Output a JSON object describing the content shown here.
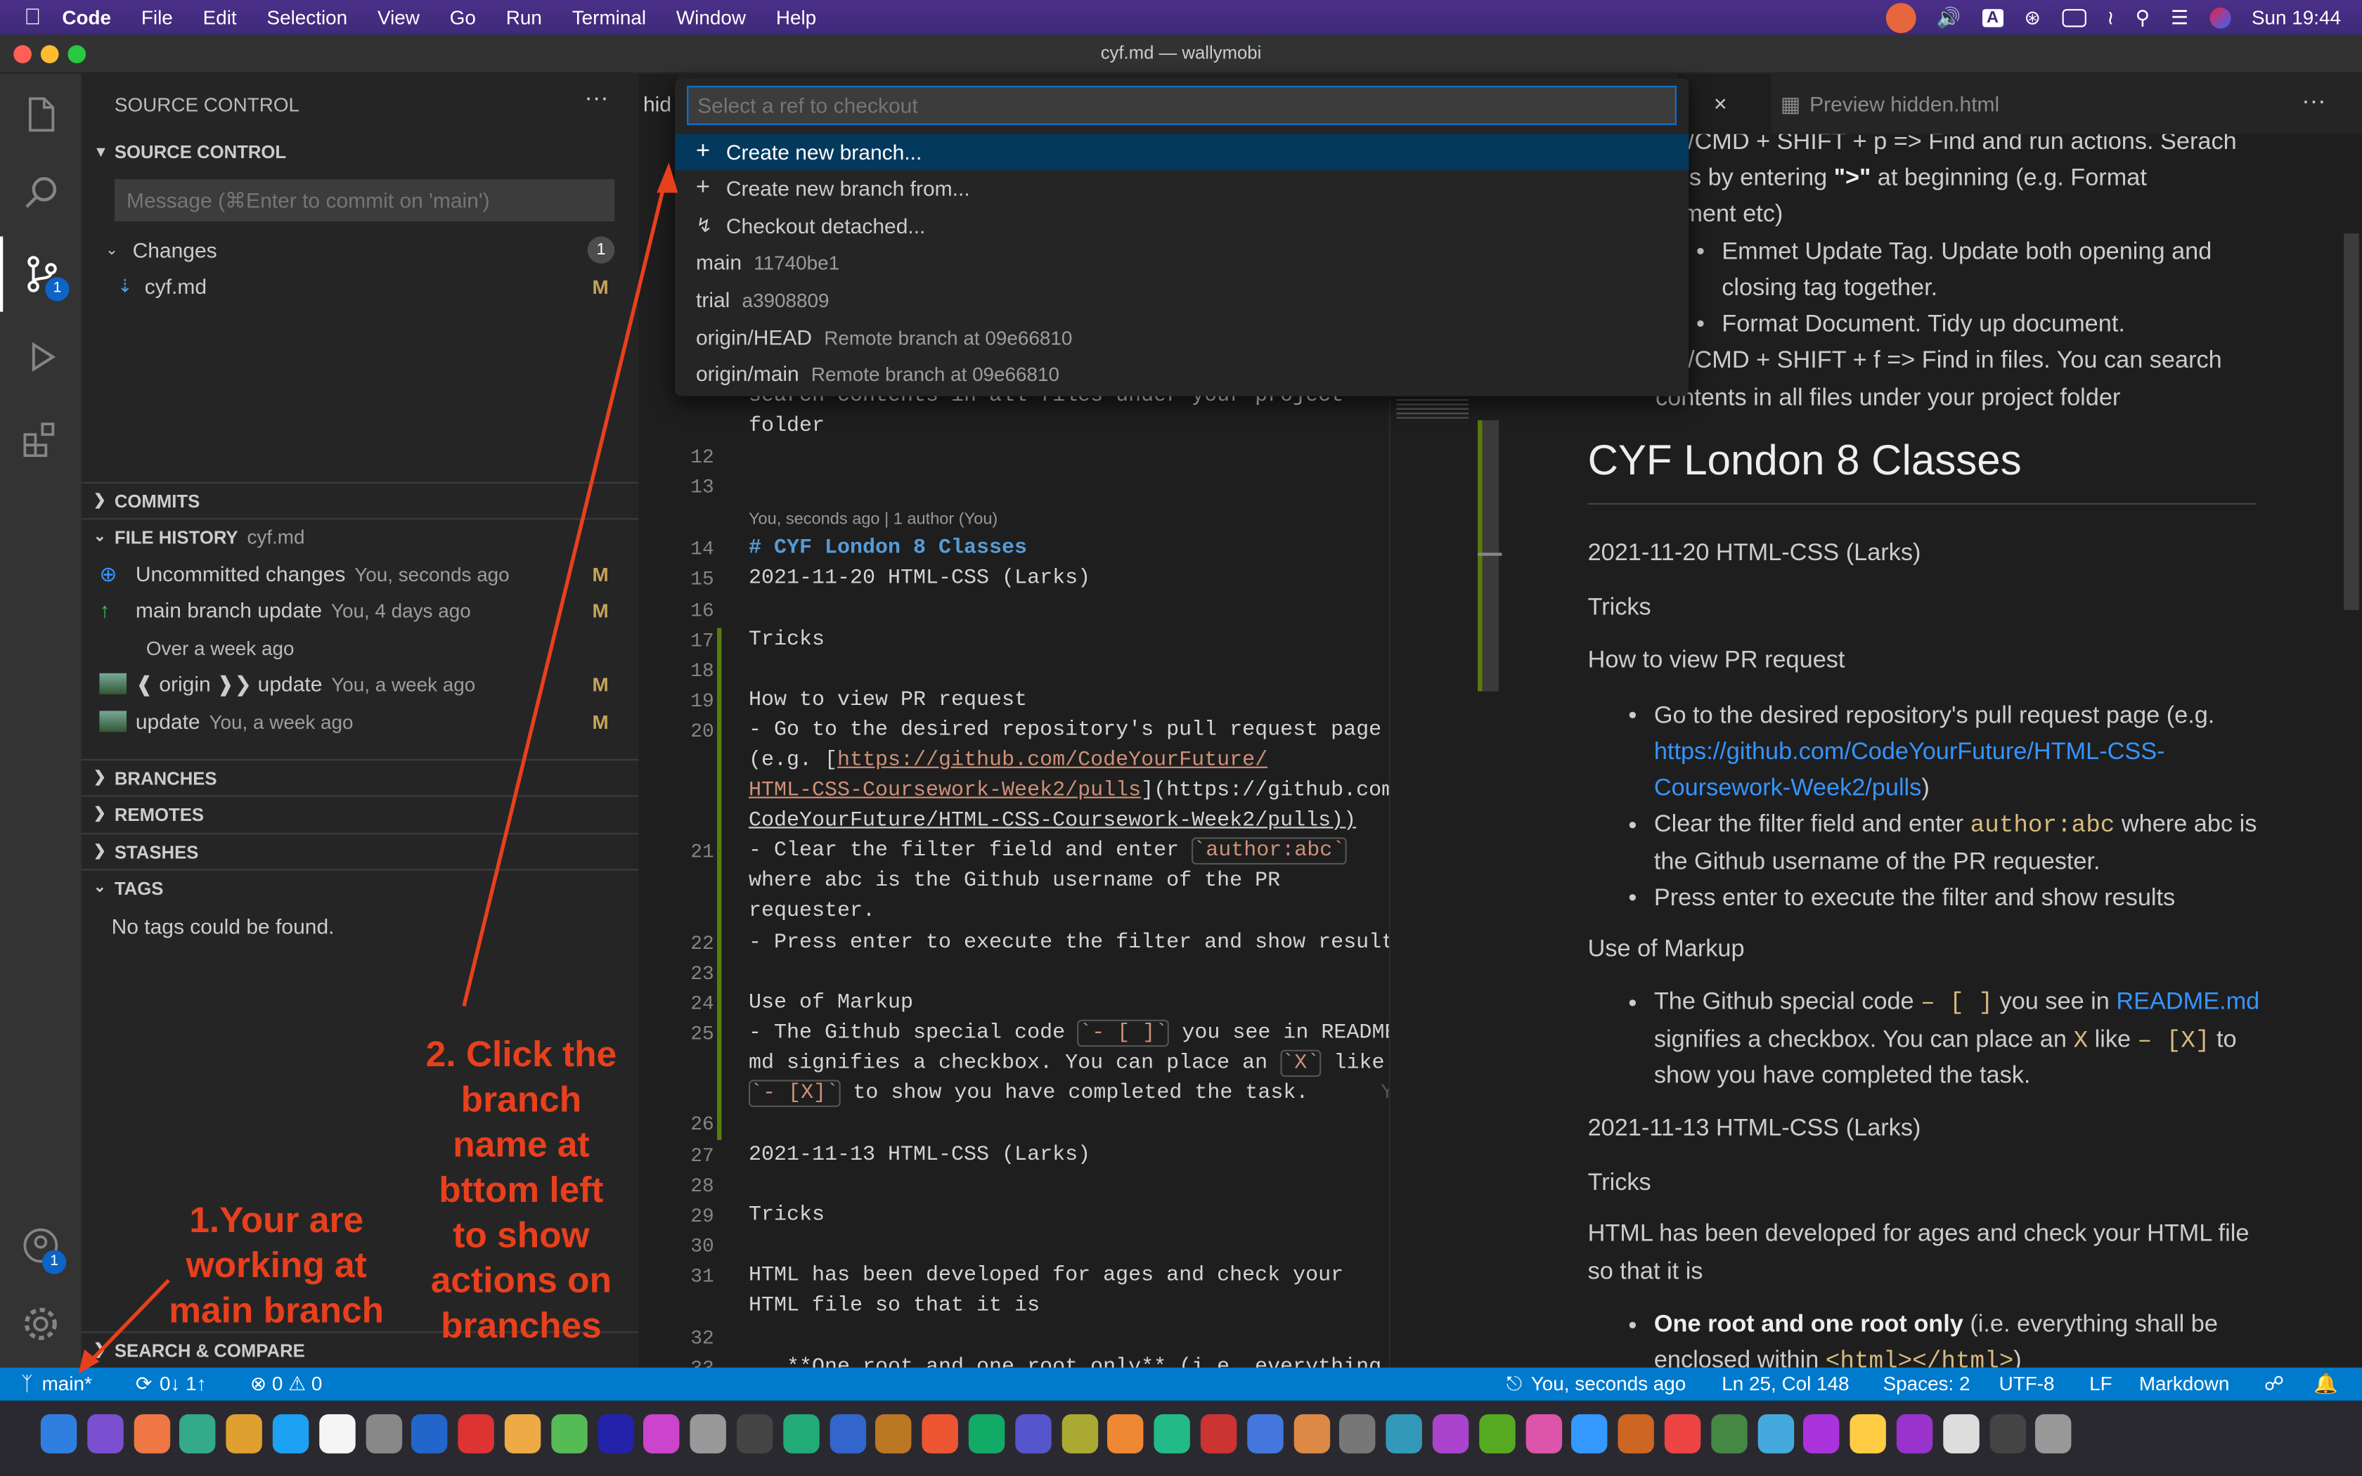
{
  "menubar": {
    "app": "Code",
    "items": [
      "File",
      "Edit",
      "Selection",
      "View",
      "Go",
      "Run",
      "Terminal",
      "Window",
      "Help"
    ],
    "clock": "Sun 19:44"
  },
  "window": {
    "title": "cyf.md — wallymobi"
  },
  "activity": {
    "scm_badge": "1",
    "account_badge": "1"
  },
  "sidebar": {
    "header": "SOURCE CONTROL",
    "section": "SOURCE CONTROL",
    "message_placeholder": "Message (⌘Enter to commit on 'main')",
    "changes_label": "Changes",
    "changes_count": "1",
    "file": "cyf.md",
    "file_flag": "M",
    "commits": "COMMITS",
    "file_history": "FILE HISTORY",
    "file_history_file": "cyf.md",
    "history": [
      {
        "label": "Uncommitted changes",
        "meta": "You, seconds ago",
        "flag": "M"
      },
      {
        "label": "main branch update",
        "meta": "You, 4 days ago",
        "flag": "M"
      },
      {
        "label": "Over a week ago",
        "meta": "",
        "flag": ""
      },
      {
        "label": "❰ origin ❱❯  update",
        "meta": "You, a week ago",
        "flag": "M"
      },
      {
        "label": "update",
        "meta": "You, a week ago",
        "flag": "M"
      }
    ],
    "branches": "BRANCHES",
    "remotes": "REMOTES",
    "stashes": "STASHES",
    "tags": "TAGS",
    "no_tags": "No tags could be found.",
    "search_compare": "SEARCH & COMPARE"
  },
  "tabs": {
    "left_fragment": "hid",
    "right_fragment": "d",
    "preview": "Preview hidden.html"
  },
  "quickpick": {
    "placeholder": "Select a ref to checkout",
    "items": [
      {
        "label": "Create new branch...",
        "sub": ""
      },
      {
        "label": "Create new branch from...",
        "sub": ""
      },
      {
        "label": "Checkout detached...",
        "sub": ""
      },
      {
        "label": "main",
        "sub": "11740be1"
      },
      {
        "label": "trial",
        "sub": "a3908809"
      },
      {
        "label": "origin/HEAD",
        "sub": "Remote branch at 09e66810"
      },
      {
        "label": "origin/main",
        "sub": "Remote branch at 09e66810"
      }
    ]
  },
  "editor": {
    "partial1": "search contents in all files under your project",
    "partial2": "folder",
    "blame": "You, seconds ago | 1 author (You)",
    "line_numbers": [
      "12",
      "13",
      "14",
      "15",
      "16",
      "17",
      "18",
      "19",
      "20",
      "21",
      "22",
      "23",
      "24",
      "25",
      "26",
      "27",
      "28",
      "29",
      "30",
      "31",
      "32",
      "33"
    ],
    "l14": "# CYF London 8 Classes",
    "l15": "2021-11-20 HTML-CSS (Larks)",
    "l17": "Tricks",
    "l19": "How to view PR request",
    "l20a": "- Go to the desired repository's pull request page",
    "l20b_pre": "(e.g. [",
    "l20b_link": "https://github.com/CodeYourFuture/",
    "l20c_link": "HTML-CSS-Coursework-Week2/pulls",
    "l20c_post": "](https://github.com/",
    "l20d": "CodeYourFuture/HTML-CSS-Coursework-Week2/pulls))",
    "l21a_pre": "- Clear the filter field and enter ",
    "l21a_code": "`author:abc`",
    "l21b": "where abc is the Github username of the PR",
    "l21c": "requester.",
    "l22": "- Press enter to execute the filter and show results",
    "l24": "Use of Markup",
    "l25a_pre": "- The Github special code ",
    "l25a_code": "`- [ ]`",
    "l25a_post": " you see in README.",
    "l25b_pre": "md signifies a checkbox. You can place an ",
    "l25b_code": "`X`",
    "l25b_post": " like",
    "l25c_code": "`- [X]`",
    "l25c_post": " to show you have completed the task.",
    "l25c_ghost": "You",
    "l27": "2021-11-13 HTML-CSS (Larks)",
    "l29": "Tricks",
    "l31a": "HTML has been developed for ages and check your",
    "l31b": "HTML file so that it is",
    "l33": "   **One root and one root only** (i.e. everything"
  },
  "preview": {
    "top1": "RL/CMD + SHIFT + p => Find and run actions. Serach",
    "top2_pre": "ions by entering ",
    "top2_bold": "\">\"",
    "top2_post": " at beginning (e.g. Format",
    "top3": "cument etc)",
    "b1a": "Emmet Update Tag. Update both opening and",
    "b1b": "closing tag together.",
    "b2": "Format Document. Tidy up document.",
    "top4": "RL/CMD + SHIFT + f => Find in files. You can search",
    "top5": "contents in all files under your project folder",
    "h1": "CYF London 8 Classes",
    "p1": "2021-11-20 HTML-CSS (Larks)",
    "p2": "Tricks",
    "p3": "How to view PR request",
    "li1a": "Go to the desired repository's pull request page (e.g.",
    "li1b_link": "https://github.com/CodeYourFuture/HTML-CSS-",
    "li1c_link": "Coursework-Week2/pulls",
    "li1c_post": ")",
    "li2a_pre": "Clear the filter field and enter ",
    "li2a_code": "author:abc",
    "li2a_post": " where abc is",
    "li2b": "the Github username of the PR requester.",
    "li3": "Press enter to execute the filter and show results",
    "p4": "Use of Markup",
    "li4a_pre": "The Github special code ",
    "li4a_code": "– [ ]",
    "li4a_mid": " you see in ",
    "li4a_link": "README.md",
    "li4b_pre": "signifies a checkbox. You can place an ",
    "li4b_code": "X",
    "li4b_mid": " like ",
    "li4b_code2": "– [X]",
    "li4b_post": " to",
    "li4c": "show you have completed the task.",
    "p5": "2021-11-13 HTML-CSS (Larks)",
    "p6": "Tricks",
    "p7a": "HTML has been developed for ages and check your HTML file",
    "p7b": "so that it is",
    "li5a_bold": "One root and one root only",
    "li5a_post": " (i.e. everything shall be",
    "li5b_pre": "enclosed within ",
    "li5b_code": "<html></html>",
    "li5b_post": ")"
  },
  "status": {
    "branch": "main*",
    "sync": "0↓ 1↑",
    "errors": "0",
    "warnings": "0",
    "blame": "You, seconds ago",
    "position": "Ln 25, Col 148",
    "spaces": "Spaces: 2",
    "encoding": "UTF-8",
    "eol": "LF",
    "language": "Markdown"
  },
  "annotations": {
    "note1": [
      "1.Your are",
      "working at",
      "main branch"
    ],
    "note2": [
      "2. Click the",
      "branch",
      "name at",
      "bttom left",
      "to show",
      "actions on",
      "branches"
    ]
  },
  "colors": {
    "accent": "#007acc",
    "annotation": "#e8401c",
    "selection": "#04395e"
  }
}
